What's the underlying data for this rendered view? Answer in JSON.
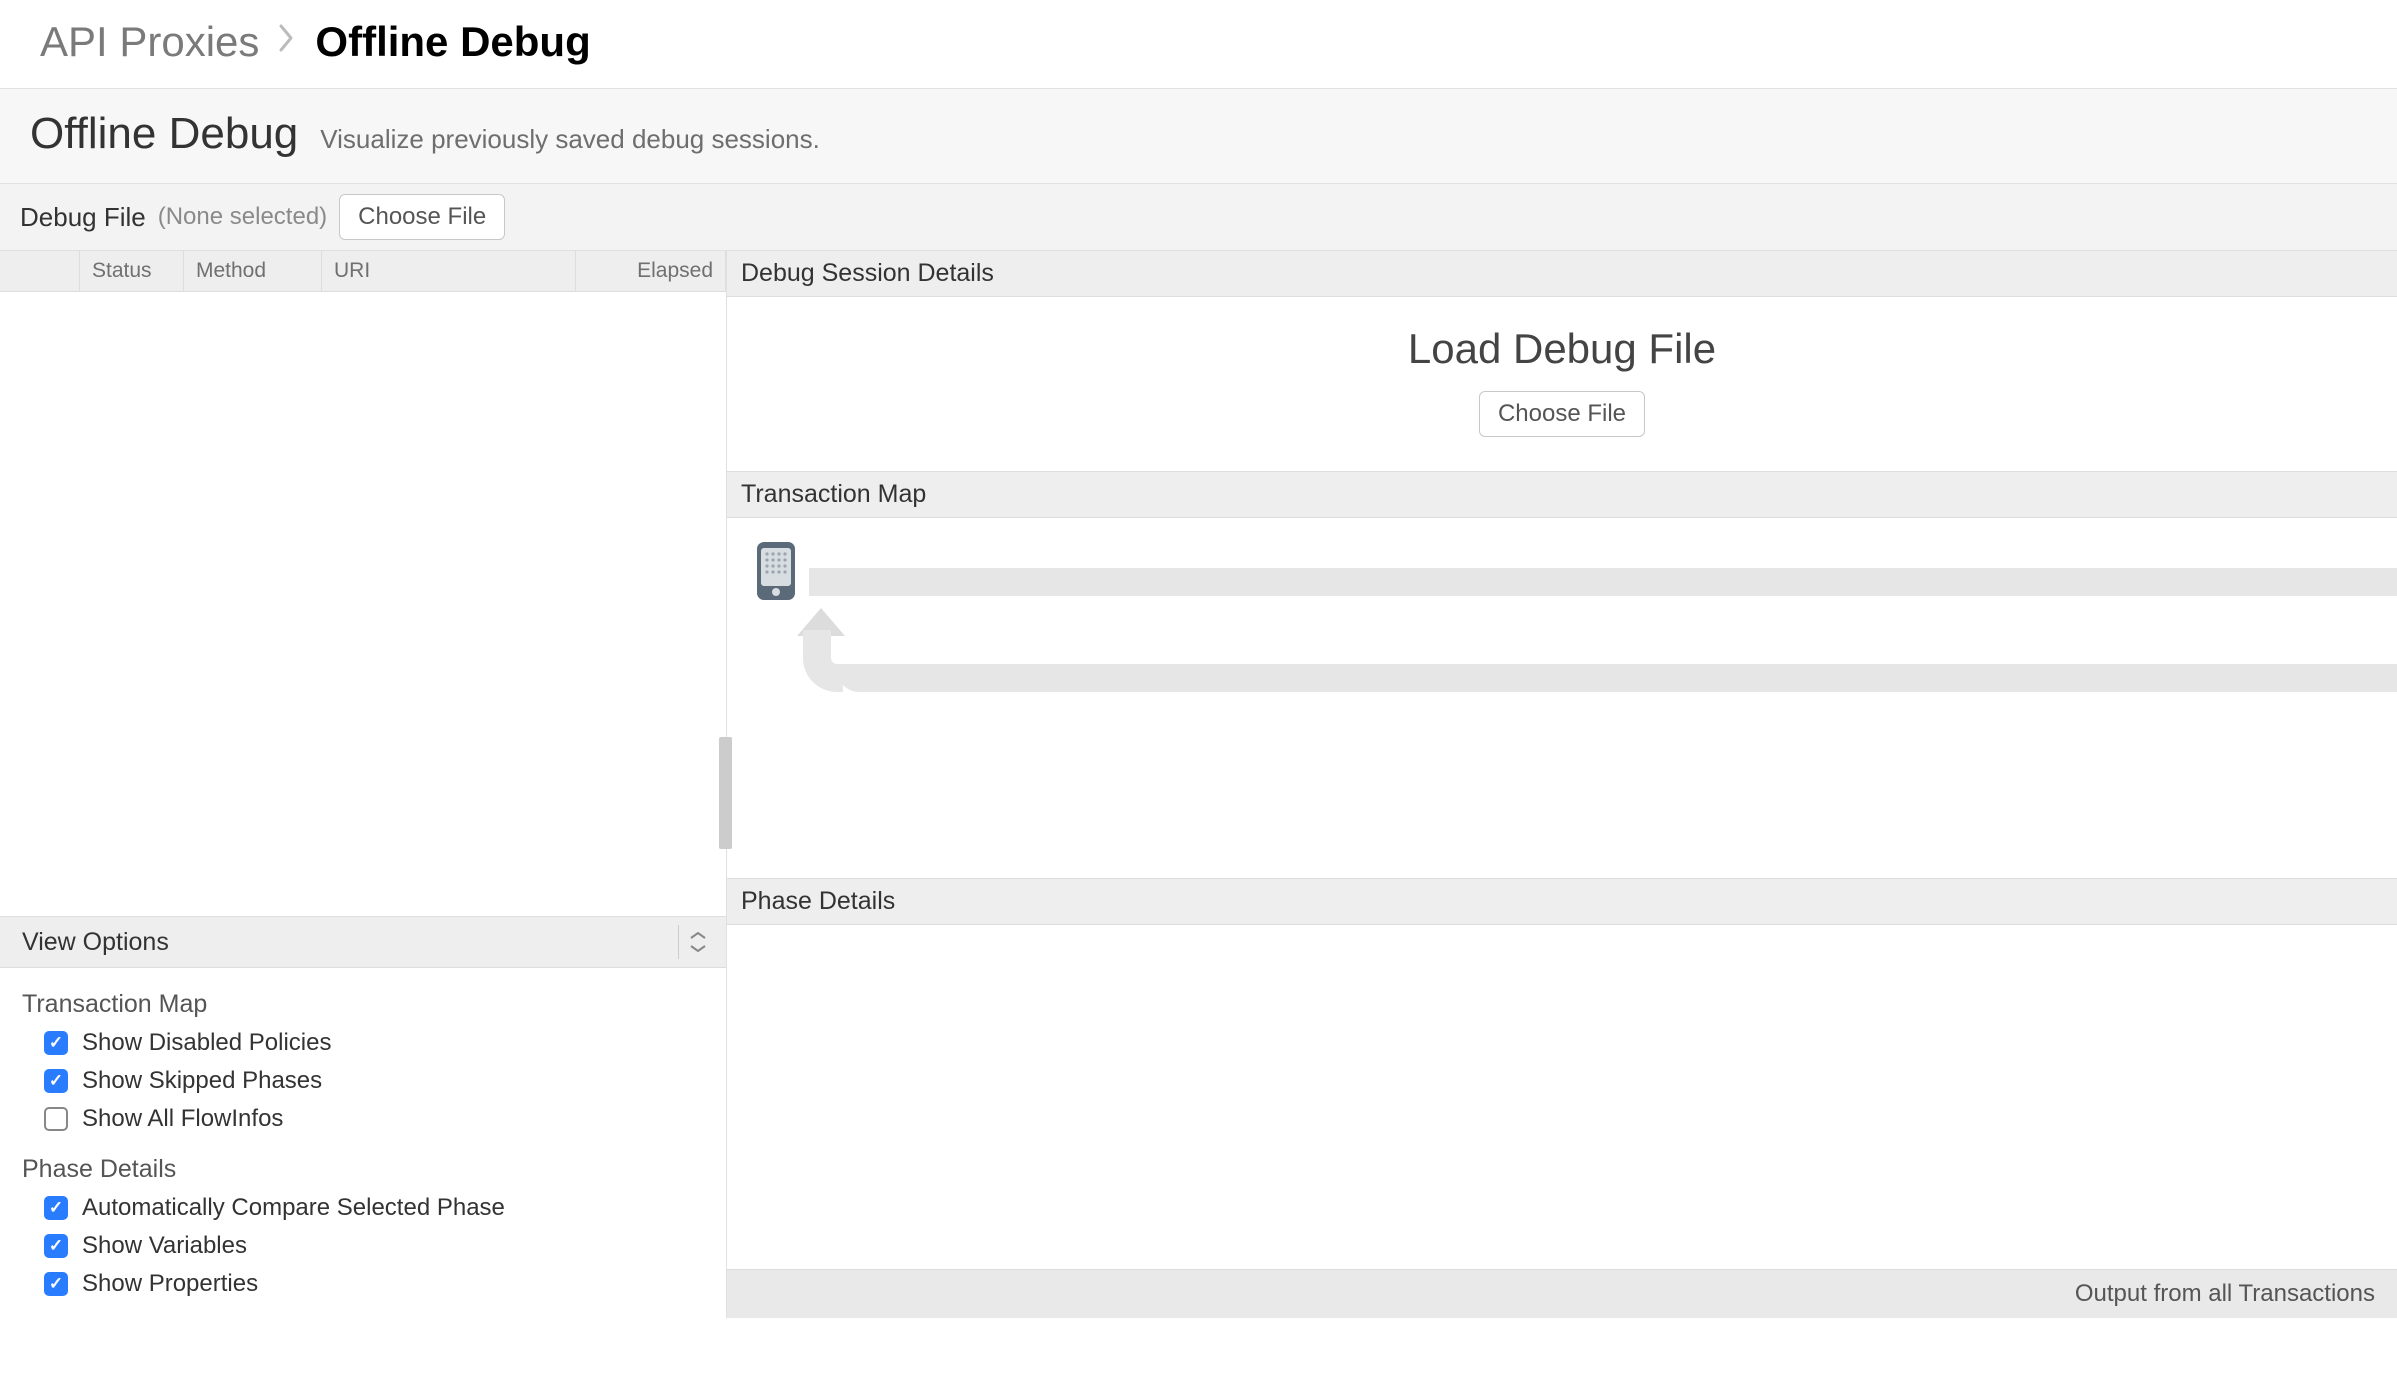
{
  "breadcrumb": {
    "parent": "API Proxies",
    "current": "Offline Debug"
  },
  "header": {
    "title": "Offline Debug",
    "subtitle": "Visualize previously saved debug sessions."
  },
  "debug_file": {
    "label": "Debug File",
    "status": "(None selected)",
    "choose_btn": "Choose File"
  },
  "table": {
    "columns": {
      "status": "Status",
      "method": "Method",
      "uri": "URI",
      "elapsed": "Elapsed"
    }
  },
  "view_options": {
    "header": "View Options",
    "sections": {
      "tmap": {
        "title": "Transaction Map",
        "items": [
          {
            "label": "Show Disabled Policies",
            "checked": true
          },
          {
            "label": "Show Skipped Phases",
            "checked": true
          },
          {
            "label": "Show All FlowInfos",
            "checked": false
          }
        ]
      },
      "phase": {
        "title": "Phase Details",
        "items": [
          {
            "label": "Automatically Compare Selected Phase",
            "checked": true
          },
          {
            "label": "Show Variables",
            "checked": true
          },
          {
            "label": "Show Properties",
            "checked": true
          }
        ]
      }
    }
  },
  "right": {
    "session_details_header": "Debug Session Details",
    "load_title": "Load Debug File",
    "load_btn": "Choose File",
    "tmap_header": "Transaction Map",
    "phase_header": "Phase Details",
    "footer": "Output from all Transactions"
  }
}
